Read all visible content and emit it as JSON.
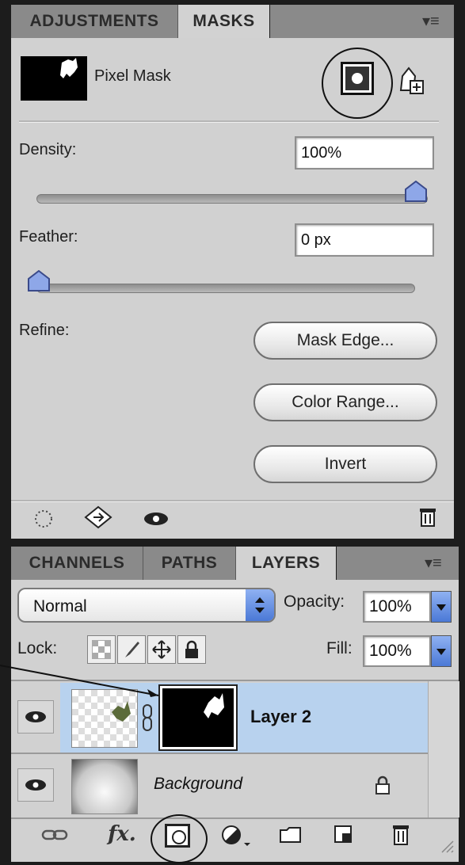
{
  "masks_panel": {
    "tabs": [
      {
        "label": "ADJUSTMENTS",
        "active": false
      },
      {
        "label": "MASKS",
        "active": true
      }
    ],
    "mask_type_label": "Pixel Mask",
    "density": {
      "label": "Density:",
      "value": "100%",
      "slider_percent": 100
    },
    "feather": {
      "label": "Feather:",
      "value": "0 px",
      "slider_percent": 0
    },
    "refine_label": "Refine:",
    "buttons": {
      "mask_edge": "Mask Edge...",
      "color_range": "Color Range...",
      "invert": "Invert"
    },
    "footer_icons": [
      "load-selection-icon",
      "apply-mask-icon",
      "visibility-icon",
      "delete-mask-icon"
    ]
  },
  "layers_panel": {
    "tabs": [
      {
        "label": "CHANNELS",
        "active": false
      },
      {
        "label": "PATHS",
        "active": false
      },
      {
        "label": "LAYERS",
        "active": true
      }
    ],
    "blend_mode": "Normal",
    "opacity_label": "Opacity:",
    "opacity_value": "100%",
    "lock_label": "Lock:",
    "fill_label": "Fill:",
    "fill_value": "100%",
    "layers": [
      {
        "name": "Layer 2",
        "selected": true,
        "visible": true,
        "has_mask": true
      },
      {
        "name": "Background",
        "selected": false,
        "visible": true,
        "locked": true
      }
    ],
    "bottom_icons": [
      "link-layers-icon",
      "fx-icon",
      "add-mask-icon",
      "adjustment-layer-icon",
      "new-group-icon",
      "new-layer-icon",
      "trash-icon"
    ]
  },
  "colors": {
    "panel_bg": "#d1d1d1",
    "selected_row": "#b8d2ee",
    "slider_thumb": "#8ea7e8"
  }
}
